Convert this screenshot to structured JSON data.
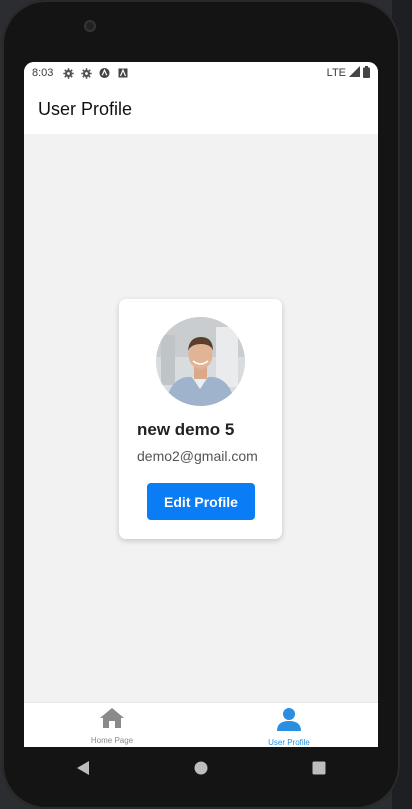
{
  "status_bar": {
    "time": "8:03",
    "network": "LTE",
    "icons": [
      "gear-icon",
      "gear-icon",
      "a-circle-icon",
      "a-square-icon",
      "signal-icon",
      "battery-icon"
    ]
  },
  "app_bar": {
    "title": "User Profile"
  },
  "profile": {
    "name": "new demo 5",
    "email": "demo2@gmail.com",
    "edit_label": "Edit Profile"
  },
  "bottom_nav": {
    "items": [
      {
        "label": "Home Page",
        "icon": "home-icon",
        "active": false
      },
      {
        "label": "User Profile",
        "icon": "person-icon",
        "active": true
      }
    ]
  },
  "colors": {
    "accent": "#0a7cf5",
    "active_tab": "#2a8fe0",
    "inactive_tab": "#8a8a8a",
    "background": "#f2f2f2"
  }
}
